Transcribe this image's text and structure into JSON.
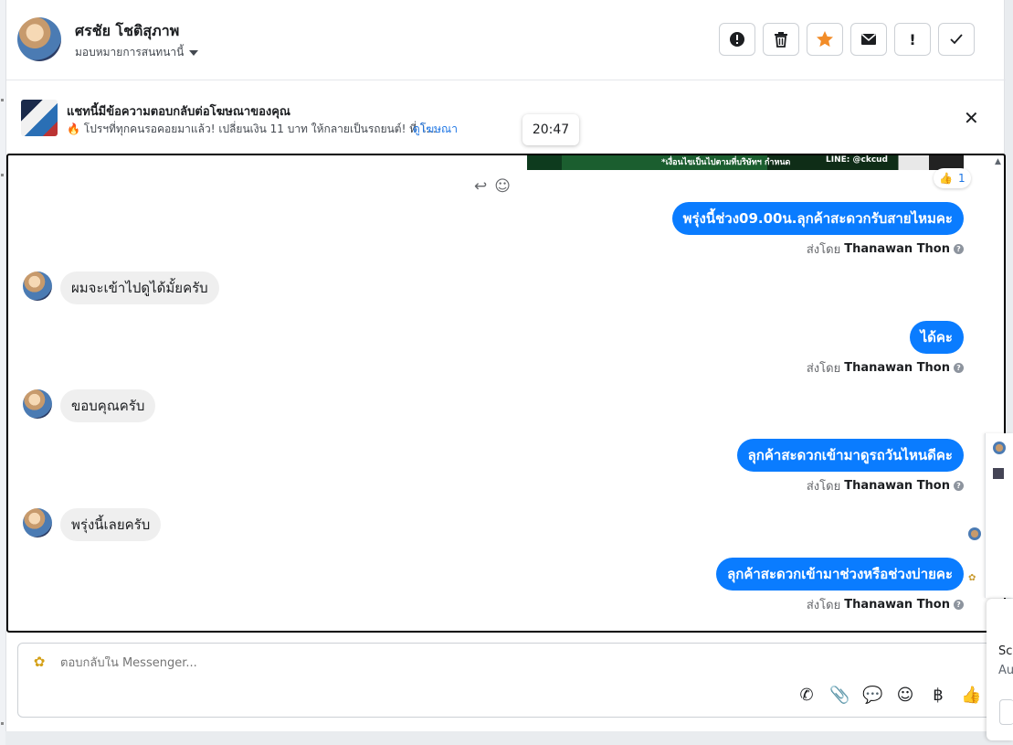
{
  "header": {
    "contact_name": "ศรชัย โชติสุภาพ",
    "assign_label": "มอบหมายการสนทนานี้",
    "actions": [
      {
        "name": "report-button",
        "icon": "alert-circle-icon",
        "glyph": "!"
      },
      {
        "name": "delete-button",
        "icon": "trash-icon",
        "glyph": "🗑"
      },
      {
        "name": "star-button",
        "icon": "star-icon",
        "glyph": "★"
      },
      {
        "name": "mark-unread-button",
        "icon": "envelope-icon",
        "glyph": "✉"
      },
      {
        "name": "flag-button",
        "icon": "exclamation-icon",
        "glyph": "!"
      },
      {
        "name": "done-button",
        "icon": "checkmark-icon",
        "glyph": "✓"
      }
    ]
  },
  "ad_bar": {
    "title": "แชทนี้มีข้อความตอบกลับต่อโฆษณาของคุณ",
    "text": "🔥 โปรฯที่ทุกคนรอคอยมาแล้ว! เปลี่ยนเงิน 11 บาท ให้กลายเป็นรถยนต์! ที่ โ...",
    "link": "ดูโฆษณา",
    "close": "✕"
  },
  "tooltip": {
    "time": "20:47"
  },
  "thread": {
    "banner_text": "*เงื่อนไขเป็นไปตามที่บริษัทฯ กำหนด",
    "banner_line": "LINE: @ckcud",
    "reaction_emoji": "👍",
    "reaction_count": "1",
    "messages": [
      {
        "dir": "out",
        "text": "พรุ่งนี้ช่วง09.00น.ลุกค้าสะดวกรับสายไหมคะ",
        "sent_by_label": "ส่งโดย",
        "sender": "Thanawan Thon"
      },
      {
        "dir": "in",
        "text": "ผมจะเข้าไปดูได้มั้ยครับ"
      },
      {
        "dir": "out",
        "text": "ได้คะ",
        "sent_by_label": "ส่งโดย",
        "sender": "Thanawan Thon"
      },
      {
        "dir": "in",
        "text": "ขอบคุณครับ"
      },
      {
        "dir": "out",
        "text": "ลุกค้าสะดวกเข้ามาดูรถวันไหนดีคะ",
        "sent_by_label": "ส่งโดย",
        "sender": "Thanawan Thon"
      },
      {
        "dir": "in",
        "text": "พรุ่งนี้เลยครับ"
      },
      {
        "dir": "out",
        "text": "ลุกค้าสะดวกเข้ามาช่วงหรือช่วงบ่ายคะ",
        "sent_by_label": "ส่งโดย",
        "sender": "Thanawan Thon"
      }
    ]
  },
  "composer": {
    "placeholder": "ตอบกลับใน Messenger...",
    "tools": [
      {
        "name": "call-icon",
        "glyph": "✆"
      },
      {
        "name": "attach-icon",
        "glyph": "📎"
      },
      {
        "name": "saved-reply-icon",
        "glyph": "💬"
      },
      {
        "name": "emoji-icon",
        "glyph": "☺"
      },
      {
        "name": "payment-icon",
        "glyph": "฿"
      },
      {
        "name": "like-icon",
        "glyph": "👍"
      }
    ]
  },
  "side_panel": {
    "line1": "Sc",
    "line2": "Au"
  }
}
